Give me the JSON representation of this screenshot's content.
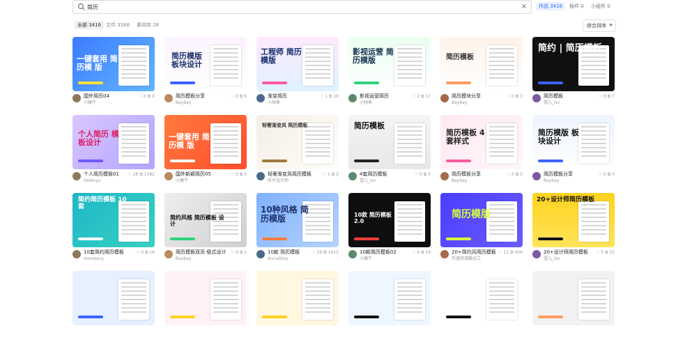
{
  "search": {
    "value": "简历",
    "clear_label": "×"
  },
  "category_tabs": [
    {
      "label": "作品 3416",
      "active": true
    },
    {
      "label": "插件 0"
    },
    {
      "label": "小组件 0"
    }
  ],
  "filter_tabs": [
    {
      "label": "全部 3416",
      "active": true
    },
    {
      "label": "文件 3388"
    },
    {
      "label": "素材库 28"
    }
  ],
  "sort": {
    "label": "综合排序"
  },
  "cards": [
    {
      "title": "国外简历04",
      "author": "小魔牛",
      "likes": "0",
      "dups": "0",
      "thumb_text": "一键套用 简历模 版"
    },
    {
      "title": "简历模板分享",
      "author": "Baybay",
      "likes": "0",
      "dups": "6",
      "thumb_text": "简历模版 板块设计"
    },
    {
      "title": "渐变简历",
      "author": "小帧鱼",
      "likes": "1",
      "dups": "10",
      "thumb_text": "工程师 简历模版"
    },
    {
      "title": "影视运营简历",
      "author": "小帧鱼",
      "likes": "2",
      "dups": "17",
      "thumb_text": "影视运营 简历模版"
    },
    {
      "title": "简历模块分享",
      "author": "Baybay",
      "likes": "0",
      "dups": "3",
      "thumb_text": "简历模板"
    },
    {
      "title": "简历模板",
      "author": "雪儿_lsx",
      "likes": "0",
      "dups": "7",
      "thumb_text": "简约 | 简历模板"
    },
    {
      "title": "个人简历模板01",
      "author": "Helenyu",
      "likes": "28",
      "dups": "1382",
      "thumb_text": "个人简历 模板设计"
    },
    {
      "title": "国外新颖简历05",
      "author": "小魔牛",
      "likes": "0",
      "dups": "0",
      "thumb_text": "一键套用 简历模 版"
    },
    {
      "title": "轻奢渐变风简历模板",
      "author": "旺仔设计师",
      "likes": "1",
      "dups": "2",
      "thumb_text": "轻奢渐变风 简历模板"
    },
    {
      "title": "4套简历模板",
      "author": "雪儿_lsx",
      "likes": "0",
      "dups": "5",
      "thumb_text": "简历模板"
    },
    {
      "title": "简历模板分享",
      "author": "Baybay",
      "likes": "0",
      "dups": "0",
      "thumb_text": "简历模板 4套样式"
    },
    {
      "title": "简历模板分享",
      "author": "Baybay",
      "likes": "0",
      "dups": "0",
      "thumb_text": "简历模版 板块设计"
    },
    {
      "title": "10套简约简历模板",
      "author": "moresecy",
      "likes": "0",
      "dups": "16",
      "thumb_text": "简约简历模板 10套"
    },
    {
      "title": "简历模板双页-极式设计",
      "author": "Baybay",
      "likes": "0",
      "dups": "2",
      "thumb_text": "简约风格 简历模板 设计"
    },
    {
      "title": "10款 简历模板",
      "author": "AnnaGrey",
      "likes": "59",
      "dups": "1613",
      "thumb_text": "10种风格 简历模版"
    },
    {
      "title": "10款简历模板02",
      "author": "小魔牛",
      "likes": "4",
      "dups": "19",
      "thumb_text": "10款 简历模板2.0"
    },
    {
      "title": "20+简约风简历模板",
      "author": "开源资源搬运工",
      "likes": "11",
      "dups": "456",
      "thumb_text": "简历模版"
    },
    {
      "title": "20+设计师简历模板",
      "author": "雪儿_lsx",
      "likes": "5",
      "dups": "33",
      "thumb_text": "20+设计师简历模板"
    },
    {
      "title": "",
      "author": "",
      "likes": "",
      "dups": "",
      "thumb_text": ""
    },
    {
      "title": "",
      "author": "",
      "likes": "",
      "dups": "",
      "thumb_text": ""
    },
    {
      "title": "",
      "author": "",
      "likes": "",
      "dups": "",
      "thumb_text": ""
    },
    {
      "title": "",
      "author": "",
      "likes": "",
      "dups": "",
      "thumb_text": ""
    },
    {
      "title": "",
      "author": "",
      "likes": "",
      "dups": "",
      "thumb_text": ""
    },
    {
      "title": "",
      "author": "",
      "likes": "",
      "dups": "",
      "thumb_text": ""
    }
  ],
  "icons": {
    "search": "search-icon",
    "like": "heart-icon",
    "duplicate": "duplicate-icon",
    "sort_chevron": "chevron-down-icon"
  },
  "colors": {
    "accent": "#2f6bff",
    "active_tab_bg": "#e9f2ff"
  }
}
